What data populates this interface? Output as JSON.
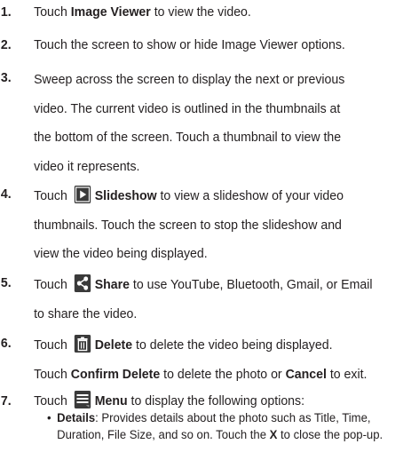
{
  "steps": [
    {
      "num": "1.",
      "lines": [
        [
          "Touch ",
          {
            "b": "Image Viewer"
          },
          " to view the video."
        ]
      ]
    },
    {
      "num": "2.",
      "lines": [
        [
          "Touch the screen to show or hide Image Viewer options."
        ]
      ]
    },
    {
      "num": "3.",
      "lines": [
        [
          "Sweep across the screen to display the next or previous"
        ],
        [
          "video. The current video is outlined in the thumbnails at"
        ],
        [
          "the bottom of the screen. Touch a thumbnail to view the"
        ],
        [
          "video it represents."
        ]
      ]
    },
    {
      "num": "4.",
      "lines": [
        [
          "Touch ",
          {
            "icon": "slideshow-icon"
          },
          {
            "b": "Slideshow"
          },
          " to view a slideshow of your video"
        ],
        [
          "thumbnails. Touch the screen to stop the slideshow and"
        ],
        [
          "view the video being displayed."
        ]
      ]
    },
    {
      "num": "5.",
      "lines": [
        [
          "Touch ",
          {
            "icon": "share-icon"
          },
          {
            "b": "Share"
          },
          " to use YouTube, Bluetooth, Gmail, or Email"
        ],
        [
          "to share the video."
        ]
      ]
    },
    {
      "num": "6.",
      "lines": [
        [
          "Touch ",
          {
            "icon": "delete-icon"
          },
          {
            "b": "Delete"
          },
          " to delete the video being displayed."
        ],
        [
          "Touch ",
          {
            "b": "Confirm Delete"
          },
          " to delete the photo or ",
          {
            "b": "Cancel"
          },
          " to exit."
        ]
      ]
    },
    {
      "num": "7.",
      "lines": [
        [
          "Touch ",
          {
            "icon": "menu-icon"
          },
          {
            "b": "Menu"
          },
          " to display the following options:"
        ]
      ]
    }
  ],
  "bullet": {
    "dot": "•",
    "lines": [
      [
        {
          "b": "Details"
        },
        ": Provides details about the photo such as Title, Time,"
      ],
      [
        "Duration, File Size, and so on. Touch the ",
        {
          "b": "X"
        },
        " to close the pop-up."
      ]
    ]
  },
  "icon_color": "#3a3a3a"
}
